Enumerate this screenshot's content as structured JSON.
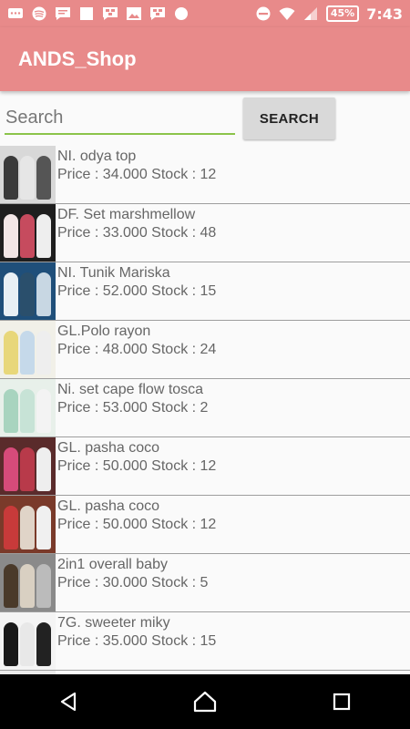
{
  "status_bar": {
    "battery": "45%",
    "time": "7:43"
  },
  "app_bar": {
    "title": "ANDS_Shop"
  },
  "search": {
    "placeholder": "Search",
    "value": "",
    "button_label": "SEARCH"
  },
  "products": [
    {
      "name": "NI. odya top",
      "meta": "Price : 34.000 Stock : 12",
      "colors": [
        "#d8d8d8",
        "#3a3a3a",
        "#e6e6e6",
        "#555"
      ]
    },
    {
      "name": "DF. Set marshmellow",
      "meta": "Price : 33.000 Stock : 48",
      "colors": [
        "#1e1e1e",
        "#f2e6e6",
        "#c64b5e",
        "#eee"
      ]
    },
    {
      "name": "NI. Tunik Mariska",
      "meta": "Price : 52.000 Stock : 15",
      "colors": [
        "#1f4f7a",
        "#e9f0f5",
        "#2a4f6c",
        "#c8d7e3"
      ]
    },
    {
      "name": "GL.Polo rayon",
      "meta": "Price : 48.000 Stock : 24",
      "colors": [
        "#f1f0e8",
        "#e8d77a",
        "#c5d9ea",
        "#eee"
      ]
    },
    {
      "name": "Ni. set cape flow tosca",
      "meta": "Price : 53.000 Stock : 2",
      "colors": [
        "#e8f0ea",
        "#a8d4bf",
        "#c7e3d6",
        "#f3f3f3"
      ]
    },
    {
      "name": "GL. pasha coco",
      "meta": "Price : 50.000 Stock : 12",
      "colors": [
        "#5a2b2b",
        "#d64b7a",
        "#b83a4a",
        "#eee"
      ]
    },
    {
      "name": "GL. pasha coco",
      "meta": "Price : 50.000 Stock : 12",
      "colors": [
        "#7a3a2a",
        "#c83a3a",
        "#e0d4c8",
        "#f0f0f0"
      ]
    },
    {
      "name": "2in1 overall baby",
      "meta": "Price : 30.000 Stock : 5",
      "colors": [
        "#8a8a8a",
        "#4a3a2a",
        "#d9d0c2",
        "#bbb"
      ]
    },
    {
      "name": "7G. sweeter miky",
      "meta": "Price : 35.000 Stock : 15",
      "colors": [
        "#f4f4f4",
        "#1a1a1a",
        "#e8e8e8",
        "#222"
      ]
    },
    {
      "name": "",
      "meta": "",
      "colors": [
        "#eaeaea",
        "#888",
        "#ddd",
        "#999"
      ]
    }
  ]
}
